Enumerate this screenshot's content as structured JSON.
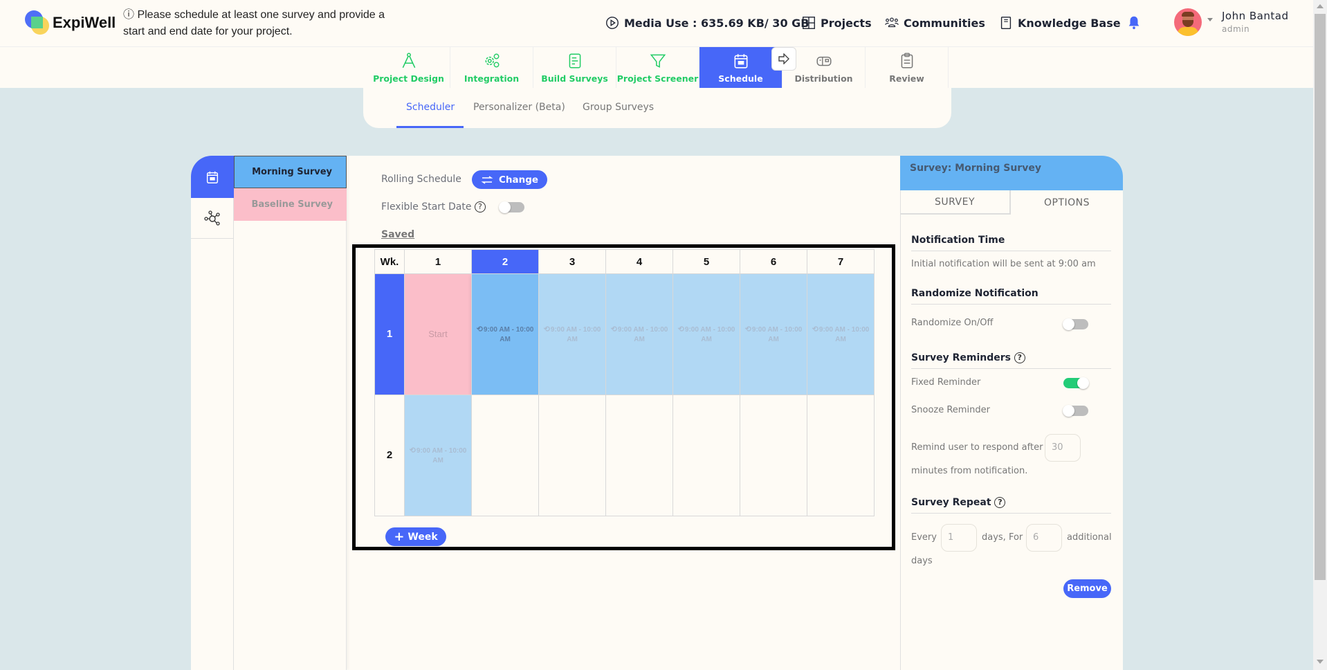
{
  "app": {
    "brand": "ExpiWell",
    "notice": "ⓘ Please schedule at least one survey and provide a start and end date for your project."
  },
  "topnav": {
    "media_use": "Media Use : 635.69 KB/ 30 GB",
    "projects": "Projects",
    "communities": "Communities",
    "knowledge_base": "Knowledge Base"
  },
  "user": {
    "name": "John Bantad",
    "role": "admin"
  },
  "steps": [
    {
      "label": "Project Design",
      "icon": "compass-icon",
      "state": "done"
    },
    {
      "label": "Integration",
      "icon": "gears-icon",
      "state": "done"
    },
    {
      "label": "Build Surveys",
      "icon": "document-icon",
      "state": "done"
    },
    {
      "label": "Project Screener",
      "icon": "filter-icon",
      "state": "done"
    },
    {
      "label": "Schedule",
      "icon": "calendar-icon",
      "state": "active"
    },
    {
      "label": "Distribution",
      "icon": "mailbox-icon",
      "state": "todo"
    },
    {
      "label": "Review",
      "icon": "clipboard-icon",
      "state": "todo"
    }
  ],
  "subtabs": [
    {
      "label": "Scheduler",
      "active": true
    },
    {
      "label": "Personalizer (Beta)",
      "active": false
    },
    {
      "label": "Group Surveys",
      "active": false
    }
  ],
  "surveys": [
    {
      "label": "Morning Survey",
      "selected": true
    },
    {
      "label": "Baseline Survey",
      "selected": false
    }
  ],
  "scheduler": {
    "rolling_label": "Rolling Schedule",
    "change_label": "Change",
    "flexible_label": "Flexible Start Date",
    "flexible_on": false,
    "saved_label": "Saved",
    "week_header": "Wk.",
    "days": [
      "1",
      "2",
      "3",
      "4",
      "5",
      "6",
      "7"
    ],
    "selected_day": "2",
    "weeks": [
      {
        "label": "1",
        "cells": [
          "Start",
          "9:00 AM - 10:00 AM",
          "9:00 AM - 10:00 AM",
          "9:00 AM - 10:00 AM",
          "9:00 AM - 10:00 AM",
          "9:00 AM - 10:00 AM",
          "9:00 AM - 10:00 AM"
        ]
      },
      {
        "label": "2",
        "cells": [
          "9:00 AM - 10:00 AM",
          "",
          "",
          "",
          "",
          "",
          ""
        ]
      }
    ],
    "add_week_label": "Week"
  },
  "panel": {
    "title": "Survey: Morning Survey",
    "tabs": [
      "SURVEY",
      "OPTIONS"
    ],
    "notification_heading": "Notification Time",
    "notification_text": "Initial notification will be sent at 9:00 am",
    "randomize_heading": "Randomize Notification",
    "randomize_label": "Randomize On/Off",
    "randomize_on": false,
    "reminders_heading": "Survey Reminders",
    "fixed_label": "Fixed Reminder",
    "fixed_on": true,
    "snooze_label": "Snooze Reminder",
    "snooze_on": false,
    "remind_prefix": "Remind user to respond after",
    "remind_minutes": "30",
    "remind_suffix": "minutes from notification.",
    "repeat_heading": "Survey Repeat",
    "every_label": "Every",
    "every_value": "1",
    "days_for_label": "days, For",
    "for_value": "6",
    "additional_label": "additional",
    "days_label": "days",
    "remove_label": "Remove"
  },
  "colors": {
    "accent": "#4767f8",
    "done": "#22cc66",
    "selected_survey": "#64b2f3",
    "baseline_survey": "#fbbec9"
  }
}
